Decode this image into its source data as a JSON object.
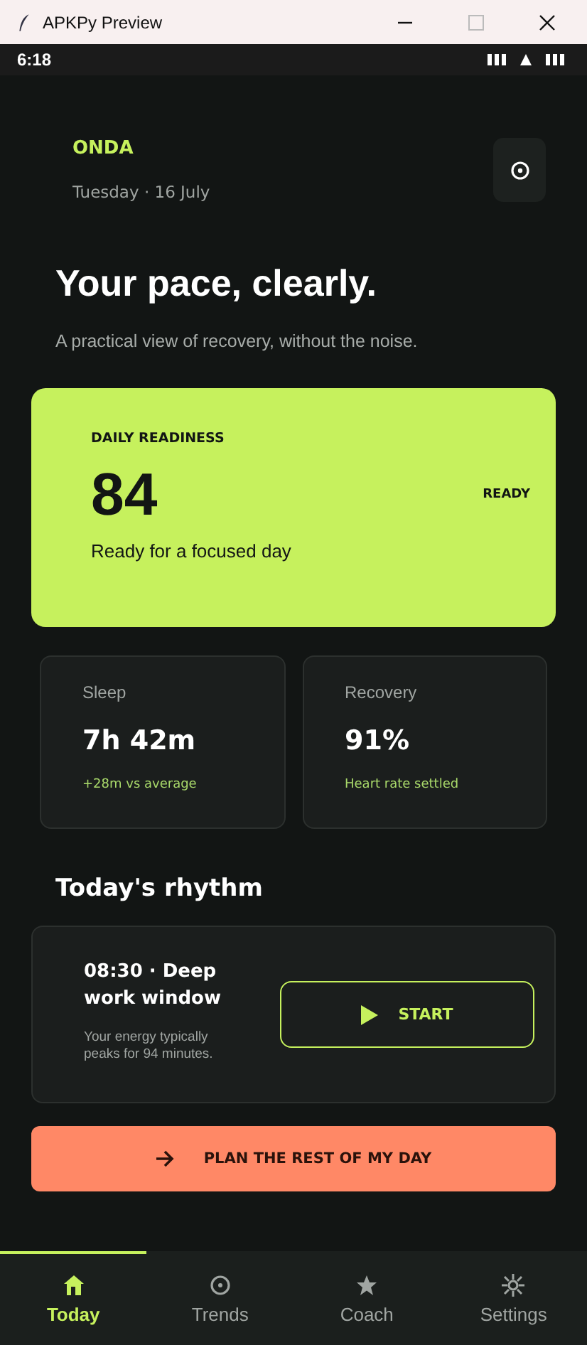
{
  "window": {
    "title": "APKPy Preview"
  },
  "status_bar": {
    "time": "6:18"
  },
  "header": {
    "brand": "ONDA",
    "date": "Tuesday · 16 July"
  },
  "hero": {
    "title": "Your pace, clearly.",
    "subtitle": "A practical view of recovery, without the noise."
  },
  "readiness": {
    "label": "DAILY READINESS",
    "score": "84",
    "status": "READY",
    "note": "Ready for a focused day"
  },
  "metrics": [
    {
      "label": "Sleep",
      "value": "7h 42m",
      "note": "+28m vs average"
    },
    {
      "label": "Recovery",
      "value": "91%",
      "note": "Heart rate settled"
    }
  ],
  "rhythm": {
    "heading": "Today's rhythm",
    "title": "08:30 · Deep work window",
    "body": "Your energy typically peaks for 94 minutes.",
    "button": "START"
  },
  "plan_button": "PLAN THE REST OF MY DAY",
  "nav": [
    {
      "label": "Today",
      "kind": "home",
      "selected": true
    },
    {
      "label": "Trends",
      "kind": "target",
      "selected": false
    },
    {
      "label": "Coach",
      "kind": "star",
      "selected": false
    },
    {
      "label": "Settings",
      "kind": "sun",
      "selected": false
    }
  ]
}
